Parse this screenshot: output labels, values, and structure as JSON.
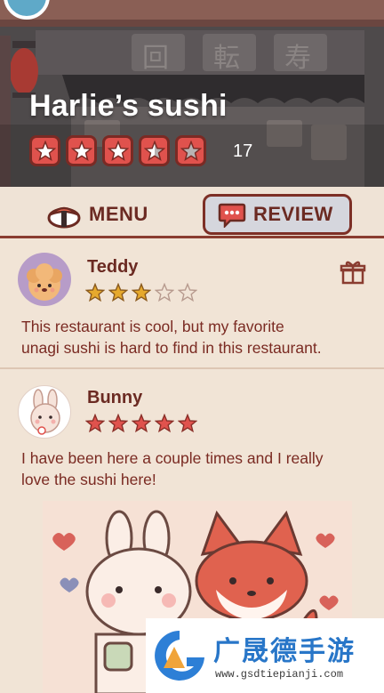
{
  "restaurant": {
    "name": "Harlie’s sushi",
    "rating": 3.5,
    "max_rating": 5,
    "rating_count": "17",
    "sign_glyphs": [
      "回",
      "転",
      "寿"
    ]
  },
  "tabs": [
    {
      "label": "MENU",
      "active": false
    },
    {
      "label": "REVIEW",
      "active": true
    }
  ],
  "reviews": [
    {
      "name": "Teddy",
      "stars": 3,
      "max_stars": 5,
      "text_lines": [
        "This restaurant is cool, but my favorite",
        "unagi sushi is hard to find in this restaurant."
      ],
      "avatar_icon": "puppy-avatar",
      "has_gift": true
    },
    {
      "name": "Bunny",
      "stars": 5,
      "max_stars": 5,
      "text_lines": [
        "I have been here a couple times and I really",
        "love the sushi here!"
      ],
      "avatar_icon": "bunny-avatar",
      "has_photo": true
    }
  ],
  "watermark": {
    "text": "广晟德手游",
    "url": "www.gsdtiepianji.com"
  },
  "colors": {
    "accent_red": "#e0524d",
    "dark_brown": "#6b2a22",
    "background": "#f1e4d6",
    "star_gold": "#e6a92d"
  }
}
